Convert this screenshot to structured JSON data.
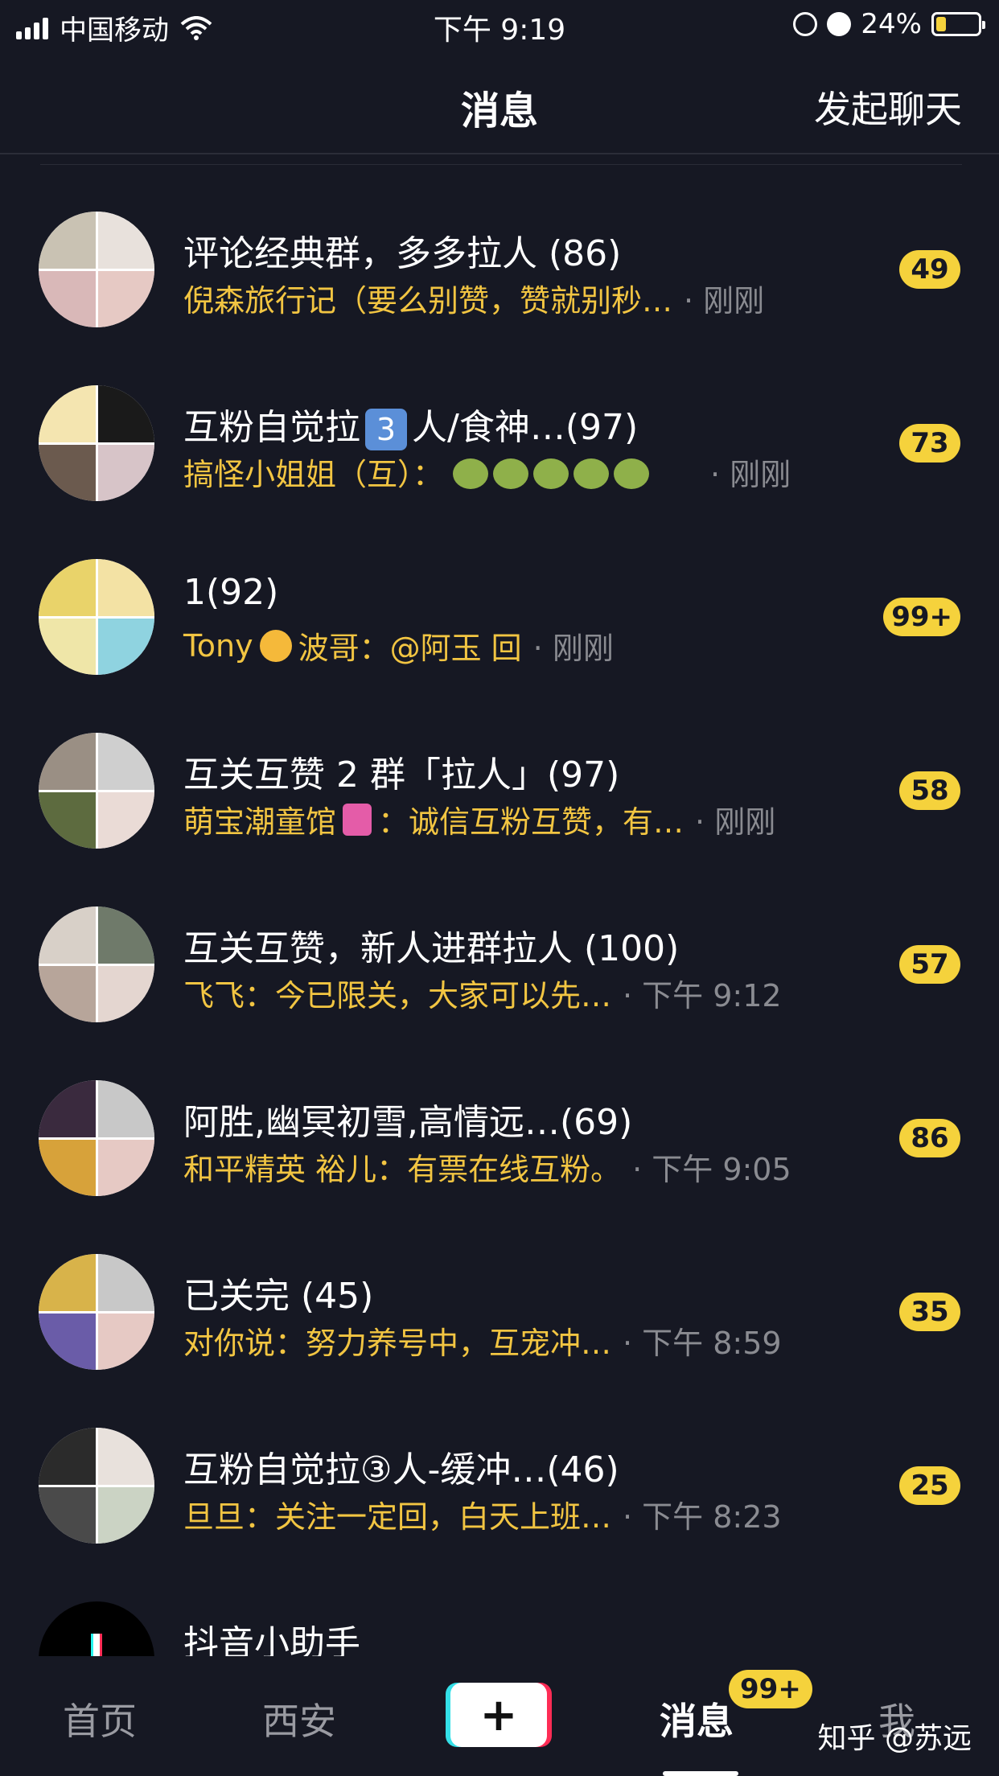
{
  "status_bar": {
    "carrier": "中国移动",
    "time": "下午 9:19",
    "battery": "24%",
    "battery_level": 0.24
  },
  "header": {
    "title": "消息",
    "action": "发起聊天"
  },
  "accent_colors": {
    "badge": "#f5d23c",
    "preview_text": "#f2c542",
    "background": "#161823"
  },
  "chats": [
    {
      "name": "评论经典群，多多拉人 (86)",
      "preview": "倪森旅行记（要么别赞，赞就别秒…",
      "time": "· 刚刚",
      "badge": "49"
    },
    {
      "name_prefix": "互粉自觉拉",
      "name_key": "3",
      "name_suffix": "人/食神…(97)",
      "preview": "搞怪小姐姐（互）：",
      "time": "· 刚刚",
      "badge": "73"
    },
    {
      "name": "1(92)",
      "preview_a": "Tony",
      "preview_b": "波哥：@阿玉 回",
      "time": "· 刚刚",
      "badge": "99+"
    },
    {
      "name": "互关互赞 2 群「拉人」(97)",
      "preview_a": "萌宝潮童馆",
      "preview_b": "：诚信互粉互赞，有…",
      "time": "· 刚刚",
      "badge": "58"
    },
    {
      "name": "互关互赞，新人进群拉人 (100)",
      "preview": "飞飞：今已限关，大家可以先…",
      "time": "· 下午 9:12",
      "badge": "57"
    },
    {
      "name": "阿胜,幽冥初雪,高情远…(69)",
      "preview": "和平精英 裕儿：有票在线互粉。",
      "time": "· 下午 9:05",
      "badge": "86"
    },
    {
      "name": "已关完 (45)",
      "preview": "对你说：努力养号中，互宠冲…",
      "time": "· 下午 8:59",
      "badge": "35"
    },
    {
      "name": "互粉自觉拉③人-缓冲…(46)",
      "preview": "旦旦：关注一定回，白天上班…",
      "time": "· 下午 8:23",
      "badge": "25"
    },
    {
      "name": "抖音小助手"
    }
  ],
  "nav": {
    "home": "首页",
    "city": "西安",
    "plus": "+",
    "messages": "消息",
    "messages_badge": "99+",
    "me": "我"
  },
  "watermark": "知乎 @苏远"
}
